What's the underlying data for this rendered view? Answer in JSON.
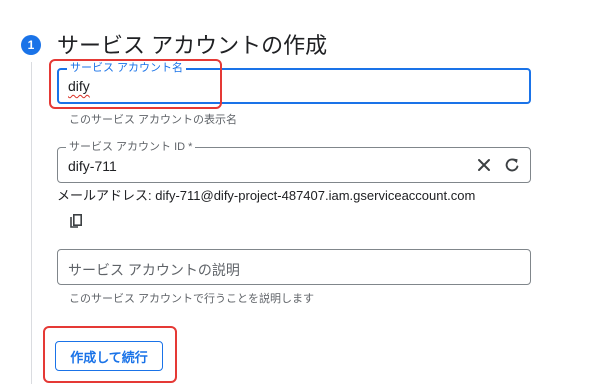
{
  "step": {
    "number": "1",
    "title": "サービス アカウントの作成"
  },
  "fields": {
    "display_name": {
      "label": "サービス アカウント名",
      "value": "dify",
      "hint": "このサービス アカウントの表示名"
    },
    "account_id": {
      "label": "サービス アカウント ID *",
      "value": "dify-711"
    },
    "description": {
      "placeholder": "サービス アカウントの説明",
      "hint": "このサービス アカウントで行うことを説明します"
    }
  },
  "email_line": "メールアドレス: dify-711@dify-project-487407.iam.gserviceaccount.com",
  "icons": {
    "clear": "close-icon",
    "regenerate": "refresh-icon",
    "copy": "copy-icon"
  },
  "buttons": {
    "create_continue": "作成して続行"
  },
  "colors": {
    "accent": "#1a73e8",
    "annotation": "#e53935"
  }
}
